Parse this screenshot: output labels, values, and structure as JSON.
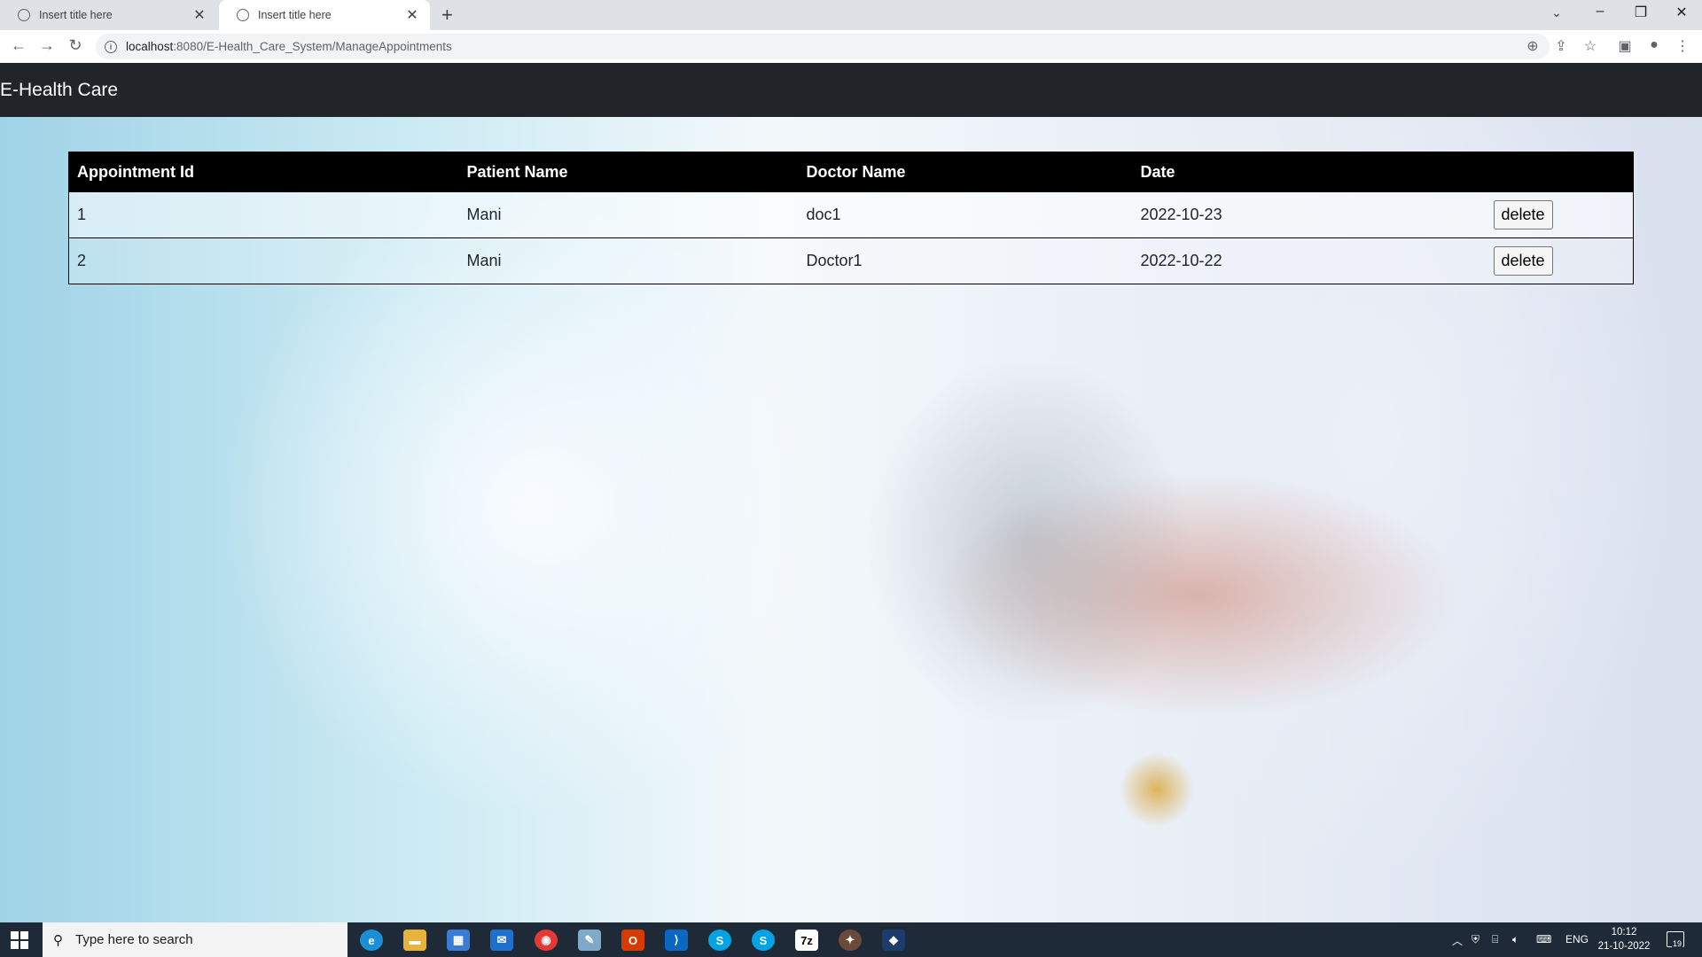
{
  "browser": {
    "tabs": [
      {
        "title": "Insert title here",
        "active": false
      },
      {
        "title": "Insert title here",
        "active": true
      }
    ],
    "url_host": "localhost",
    "url_path": ":8080/E-Health_Care_System/ManageAppointments",
    "icons": {
      "back": "arrow-left-icon",
      "forward": "arrow-right-icon",
      "reload": "reload-icon",
      "zoom": "zoom-icon",
      "share": "share-icon",
      "bookmark": "star-icon",
      "sidepanel": "side-panel-icon",
      "profile": "profile-icon",
      "menu": "kebab-menu-icon"
    }
  },
  "app": {
    "brand": "E-Health Care",
    "navbar_color": "#212529"
  },
  "appointments": {
    "headers": [
      "Appointment Id",
      "Patient Name",
      "Doctor Name",
      "Date"
    ],
    "rows": [
      {
        "id": "1",
        "patient": "Mani",
        "doctor": "doc1",
        "date": "2022-10-23",
        "action": "delete"
      },
      {
        "id": "2",
        "patient": "Mani",
        "doctor": "Doctor1",
        "date": "2022-10-22",
        "action": "delete"
      }
    ]
  },
  "taskbar": {
    "search_placeholder": "Type here to search",
    "pinned": [
      "Edge",
      "File Explorer",
      "Microsoft Store",
      "Mail",
      "Chrome",
      "Notepad",
      "Office",
      "VS Code",
      "Skype",
      "Skype",
      "7-Zip",
      "App",
      "App"
    ],
    "language": "ENG",
    "time": "10:12",
    "date": "21-10-2022",
    "notifications": "19"
  }
}
